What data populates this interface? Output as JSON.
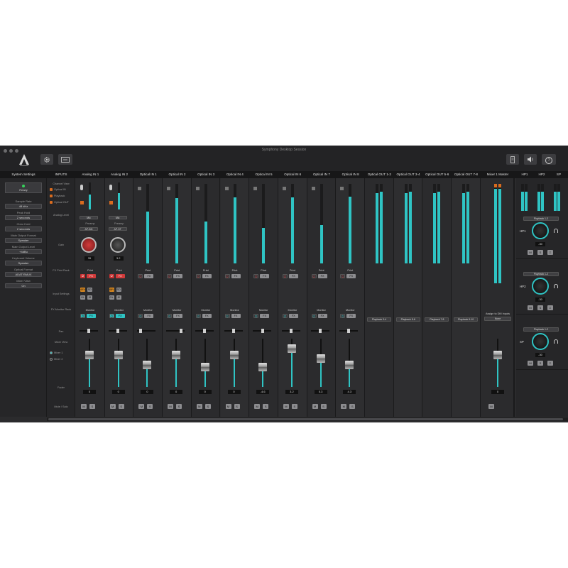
{
  "window": {
    "title": "Symphony Desktop Session",
    "brand_color": "#2fc4c4"
  },
  "toolbar": {
    "icons": [
      "apogee-logo-icon",
      "gear-icon",
      "io-routing-icon"
    ],
    "right_icons": [
      "device-icon",
      "speaker-icon",
      "help-icon"
    ],
    "help_label": "?"
  },
  "system": {
    "header": "System Settings",
    "status": "Ready",
    "settings": [
      {
        "label": "Sample Rate",
        "value": "48 kHz"
      },
      {
        "label": "Peak Hold",
        "value": "2 seconds"
      },
      {
        "label": "Clear Hold",
        "value": "2 seconds"
      },
      {
        "label": "Main Output Format",
        "value": "Speaker"
      },
      {
        "label": "Main Output Level",
        "value": "+4dBu"
      },
      {
        "label": "Keyboard Volume",
        "value": "Speaker"
      },
      {
        "label": "Optical Format",
        "value": "ADAT/SMUX"
      },
      {
        "label": "Mixer View",
        "value": "On"
      }
    ]
  },
  "inputs": {
    "header": "INPUTS",
    "rows": [
      "Channel View",
      "Analog Level",
      "Gain",
      "FX Print Rack",
      "Input Settings",
      "FX Monitor Rack",
      "Pan",
      "Mixer View",
      "Fader",
      "Mute / Solo"
    ],
    "channel_view_options": [
      "Optical IN",
      "Playback",
      "Optical OUT"
    ],
    "mixer_view_options": [
      "Mixer 1",
      "Mixer 2"
    ]
  },
  "labels": {
    "print": "Print",
    "monitor": "Monitor",
    "fx": "FX",
    "mute": "M",
    "solo": "S",
    "stereo": "Σ",
    "mic": "Mic",
    "preamp": "Preamp",
    "phantom": "48V",
    "stereo_link": "SD",
    "ground_lift": "GL",
    "phase": "Ø",
    "power": "⏻"
  },
  "channels": [
    {
      "name": "Analog IN 1",
      "type": "analog",
      "level": 0.55,
      "gain": "35",
      "preamp": "AP-BG",
      "fader_db": "0",
      "fader_pos": 0.3,
      "pan": 0.5,
      "fx_active": true
    },
    {
      "name": "Analog IN 2",
      "type": "analog",
      "level": 0.6,
      "gain": "3.2",
      "preamp": "AP-ST",
      "fader_db": "0",
      "fader_pos": 0.3,
      "pan": 0.5,
      "fx_active": true
    },
    {
      "name": "Optical IN 1",
      "type": "optical",
      "level": 0.65,
      "fader_db": "0",
      "fader_pos": 0.55,
      "pan": 0.1,
      "fx_active": false
    },
    {
      "name": "Optical IN 2",
      "type": "optical",
      "level": 0.82,
      "fader_db": "0",
      "fader_pos": 0.3,
      "pan": 0.85,
      "fx_active": false
    },
    {
      "name": "Optical IN 3",
      "type": "optical",
      "level": 0.53,
      "fader_db": "0",
      "fader_pos": 0.6,
      "pan": 0.5,
      "fx_active": false
    },
    {
      "name": "Optical IN 4",
      "type": "optical",
      "level": 0.83,
      "fader_db": "0",
      "fader_pos": 0.3,
      "pan": 0.5,
      "fx_active": false
    },
    {
      "name": "Optical IN 5",
      "type": "optical",
      "level": 0.45,
      "fader_db": "-4.6",
      "fader_pos": 0.6,
      "pan": 0.55,
      "fx_active": false
    },
    {
      "name": "Optical IN 6",
      "type": "optical",
      "level": 0.83,
      "fader_db": "3.2",
      "fader_pos": 0.15,
      "pan": 0.5,
      "fx_active": false
    },
    {
      "name": "Optical IN 7",
      "type": "optical",
      "level": 0.48,
      "fader_db": "0.3",
      "fader_pos": 0.4,
      "pan": 0.5,
      "fx_active": false
    },
    {
      "name": "Optical IN 8",
      "type": "optical",
      "level": 0.84,
      "fader_db": "4.3",
      "fader_pos": 0.55,
      "pan": 0.5,
      "fx_active": false
    }
  ],
  "outputs": [
    {
      "name": "Optical OUT 1-2",
      "assign": "Playback 3-4",
      "level": [
        0.88,
        0.9
      ]
    },
    {
      "name": "Optical OUT 3-4",
      "assign": "Playback 5-6",
      "level": [
        0.88,
        0.9
      ]
    },
    {
      "name": "Optical OUT 5-6",
      "assign": "Playback 7-8",
      "level": [
        0.88,
        0.9
      ]
    },
    {
      "name": "Optical OUT 7-8",
      "assign": "Playback 9-10",
      "level": [
        0.88,
        0.9
      ]
    }
  ],
  "master": {
    "name": "Mixer 1 Master",
    "assign_label": "Assign to DM Inputs",
    "assign_value": "None",
    "fader_db": "0",
    "fader_pos": 0.3,
    "level": [
      0.95,
      0.95
    ]
  },
  "headphones": [
    {
      "name": "HP1",
      "source": "Playback 1-2",
      "value": "-30",
      "level": [
        0.7,
        0.7
      ]
    },
    {
      "name": "HP2",
      "source": "Playback 1-2",
      "value": "-30",
      "level": [
        0.7,
        0.7
      ]
    },
    {
      "name": "SP",
      "source": "Playback 1-2",
      "value": "-30",
      "level": [
        0.7,
        0.7
      ]
    }
  ]
}
